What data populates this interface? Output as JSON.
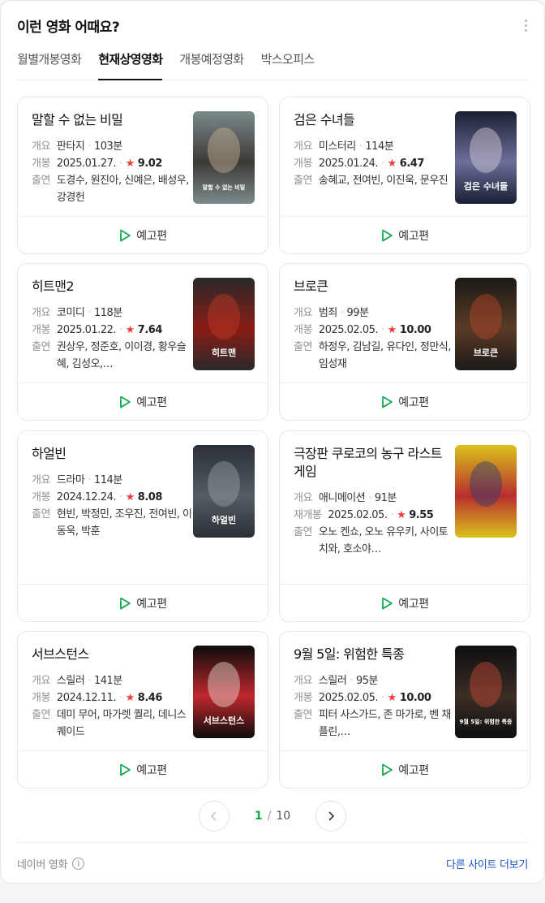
{
  "header": {
    "title": "이런 영화 어때요?"
  },
  "tabs": [
    {
      "label": "월별개봉영화"
    },
    {
      "label": "현재상영영화",
      "active": true
    },
    {
      "label": "개봉예정영화"
    },
    {
      "label": "박스오피스"
    }
  ],
  "labels": {
    "genre": "개요",
    "release": "개봉",
    "rerelease": "재개봉",
    "cast": "출연",
    "trailer": "예고편",
    "star": "★"
  },
  "movies": [
    {
      "title": "말할 수 없는 비밀",
      "genre": "판타지",
      "runtime": "103분",
      "release_label": "개봉",
      "date": "2025.01.27.",
      "rating": "9.02",
      "cast": "도경수, 원진아, 신예은, 배성우, 강경헌",
      "poster_text": "말할 수 없는 비밀"
    },
    {
      "title": "검은 수녀들",
      "genre": "미스터리",
      "runtime": "114분",
      "release_label": "개봉",
      "date": "2025.01.24.",
      "rating": "6.47",
      "cast": "송혜교, 전여빈, 이진욱, 문우진",
      "poster_text": "검은 수녀들"
    },
    {
      "title": "히트맨2",
      "genre": "코미디",
      "runtime": "118분",
      "release_label": "개봉",
      "date": "2025.01.22.",
      "rating": "7.64",
      "cast": "권상우, 정준호, 이이경, 황우슬혜, 김성오,…",
      "poster_text": "히트맨"
    },
    {
      "title": "브로큰",
      "genre": "범죄",
      "runtime": "99분",
      "release_label": "개봉",
      "date": "2025.02.05.",
      "rating": "10.00",
      "cast": "하정우, 김남길, 유다인, 정만식, 임성재",
      "poster_text": "브로큰"
    },
    {
      "title": "하얼빈",
      "genre": "드라마",
      "runtime": "114분",
      "release_label": "개봉",
      "date": "2024.12.24.",
      "rating": "8.08",
      "cast": "현빈, 박정민, 조우진, 전여빈, 이동욱, 박훈",
      "poster_text": "하얼빈"
    },
    {
      "title": "극장판 쿠로코의 농구 라스트 게임",
      "genre": "애니메이션",
      "runtime": "91분",
      "release_label": "재개봉",
      "date": "2025.02.05.",
      "rating": "9.55",
      "cast": "오노 켄쇼, 오노 유우키, 사이토 치와, 호소야…",
      "poster_text": ""
    },
    {
      "title": "서브스턴스",
      "genre": "스릴러",
      "runtime": "141분",
      "release_label": "개봉",
      "date": "2024.12.11.",
      "rating": "8.46",
      "cast": "데미 무어, 마가렛 퀄리, 데니스 퀘이드",
      "poster_text": "서브스턴스"
    },
    {
      "title": "9월 5일: 위험한 특종",
      "genre": "스릴러",
      "runtime": "95분",
      "release_label": "개봉",
      "date": "2025.02.05.",
      "rating": "10.00",
      "cast": "피터 사스가드, 존 마가로, 벤 채플린,…",
      "poster_text": "9월 5일: 위험한 특종"
    }
  ],
  "pagination": {
    "current": "1",
    "separator": "/",
    "total": "10"
  },
  "footer": {
    "source": "네이버 영화",
    "info_glyph": "i",
    "other_sites": "다른 사이트 더보기"
  },
  "colors": {
    "accent_green": "#0fa84a",
    "star_red": "#f23c3c",
    "link_blue": "#1a56c8"
  }
}
